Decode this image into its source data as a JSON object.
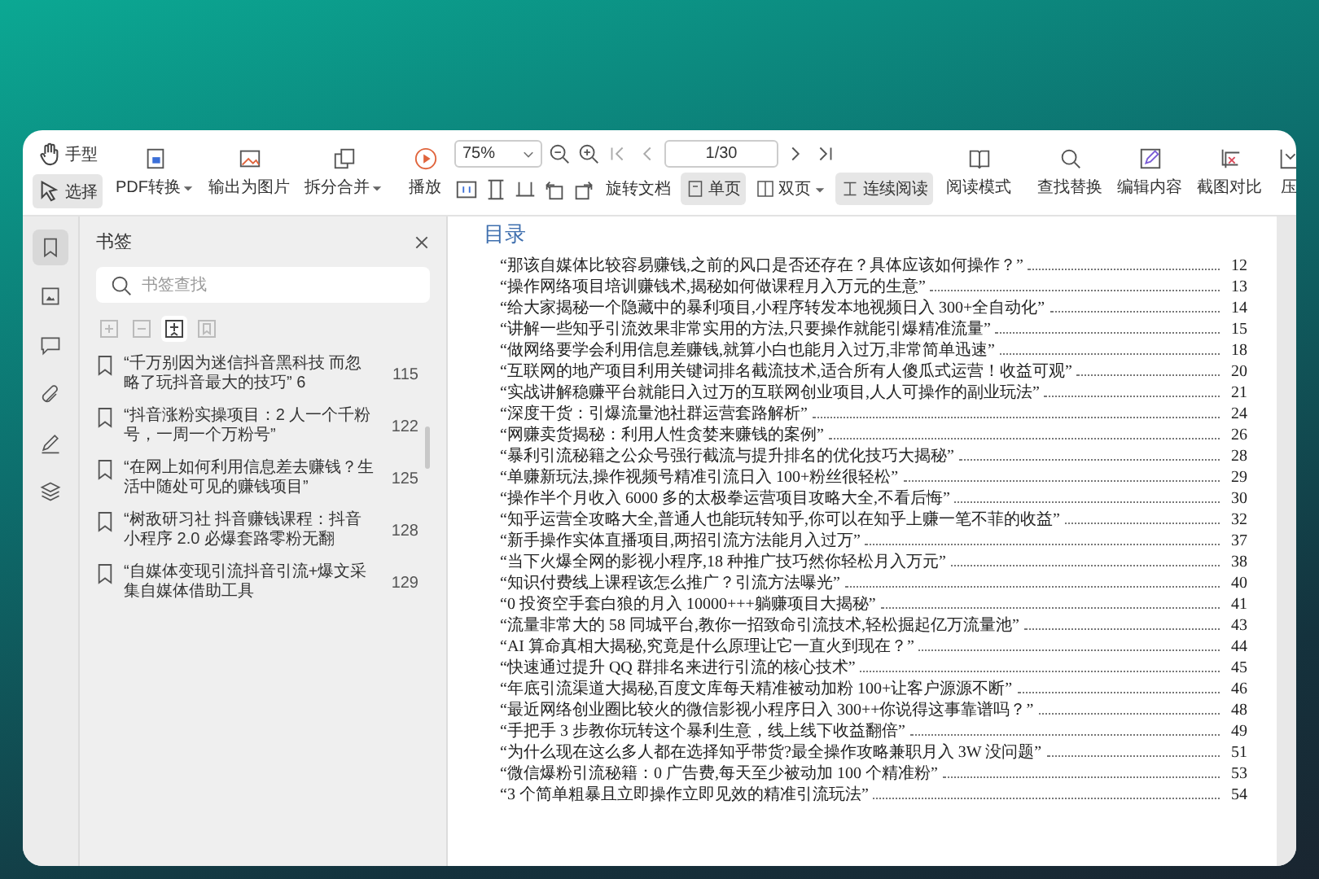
{
  "toolbar": {
    "hand": {
      "label": "手型",
      "selected": false
    },
    "select": {
      "label": "选择",
      "selected": true
    },
    "file_tools": [
      {
        "label": "PDF转换",
        "dropdown": true
      },
      {
        "label": "输出为图片",
        "dropdown": false
      },
      {
        "label": "拆分合并",
        "dropdown": true
      }
    ],
    "play": {
      "label": "播放"
    },
    "zoom": {
      "value": "75%"
    },
    "page": {
      "value": "1/30"
    },
    "rotate": {
      "label": "旋转文档"
    },
    "view_modes": [
      {
        "label": "单页",
        "selected": true,
        "dropdown": false
      },
      {
        "label": "双页",
        "selected": false,
        "dropdown": true
      },
      {
        "label": "连续阅读",
        "selected": true,
        "dropdown": false
      }
    ],
    "reading_mode": {
      "label": "阅读模式"
    },
    "tools": [
      {
        "label": "查找替换"
      },
      {
        "label": "编辑内容"
      },
      {
        "label": "截图对比"
      },
      {
        "label": "压"
      }
    ]
  },
  "sidebar": {
    "rail": [
      {
        "selected": true
      },
      {
        "selected": false
      },
      {
        "selected": false
      },
      {
        "selected": false
      },
      {
        "selected": false
      },
      {
        "selected": false
      }
    ],
    "title": "书签",
    "search": {
      "placeholder": "书签查找"
    },
    "outline_tools": [
      {
        "selected": false
      },
      {
        "selected": false
      },
      {
        "selected": true
      },
      {
        "selected": false
      }
    ],
    "bookmarks": [
      {
        "text": "“千万别因为迷信抖音黑科技 而忽略了玩抖音最大的技巧” 6",
        "page": "115"
      },
      {
        "text": "“抖音涨粉实操项目：2 人一个千粉号，一周一个万粉号”",
        "page": "122"
      },
      {
        "text": "“在网上如何利用信息差去赚钱？生活中随处可见的赚钱项目”",
        "page": "125"
      },
      {
        "text": "“树敌研习社 抖音赚钱课程：抖音小程序 2.0 必爆套路零粉无翻",
        "page": "128"
      },
      {
        "text": "“自媒体变现引流抖音引流+爆文采集自媒体借助工具",
        "page": "129"
      }
    ]
  },
  "document": {
    "heading": "目录",
    "toc": [
      {
        "title": "“那该自媒体比较容易赚钱,之前的风口是否还存在？具体应该如何操作？”",
        "page": "12"
      },
      {
        "title": "“操作网络项目培训赚钱术,揭秘如何做课程月入万元的生意”",
        "page": "13"
      },
      {
        "title": "“给大家揭秘一个隐藏中的暴利项目,小程序转发本地视频日入 300+全自动化”",
        "page": "14"
      },
      {
        "title": "“讲解一些知乎引流效果非常实用的方法,只要操作就能引爆精准流量”",
        "page": "15"
      },
      {
        "title": "“做网络要学会利用信息差赚钱,就算小白也能月入过万,非常简单迅速”",
        "page": "18"
      },
      {
        "title": "“互联网的地产项目利用关键词排名截流技术,适合所有人傻瓜式运营！收益可观”",
        "page": "20"
      },
      {
        "title": "“实战讲解稳赚平台就能日入过万的互联网创业项目,人人可操作的副业玩法”",
        "page": "21"
      },
      {
        "title": "“深度干货：引爆流量池社群运营套路解析”",
        "page": "24"
      },
      {
        "title": "“网赚卖货揭秘：利用人性贪婪来赚钱的案例”",
        "page": "26"
      },
      {
        "title": "“暴利引流秘籍之公众号强行截流与提升排名的优化技巧大揭秘”",
        "page": "28"
      },
      {
        "title": "“单赚新玩法,操作视频号精准引流日入 100+粉丝很轻松”",
        "page": "29"
      },
      {
        "title": "“操作半个月收入 6000 多的太极拳运营项目攻略大全,不看后悔”",
        "page": "30"
      },
      {
        "title": "“知乎运营全攻略大全,普通人也能玩转知乎,你可以在知乎上赚一笔不菲的收益”",
        "page": "32"
      },
      {
        "title": "“新手操作实体直播项目,两招引流方法能月入过万”",
        "page": "37"
      },
      {
        "title": "“当下火爆全网的影视小程序,18 种推广技巧然你轻松月入万元”",
        "page": "38"
      },
      {
        "title": "“知识付费线上课程该怎么推广？引流方法曝光”",
        "page": "40"
      },
      {
        "title": "“0 投资空手套白狼的月入 10000+++躺赚项目大揭秘”",
        "page": "41"
      },
      {
        "title": "“流量非常大的 58 同城平台,教你一招致命引流技术,轻松掘起亿万流量池”",
        "page": "43"
      },
      {
        "title": "“AI 算命真相大揭秘,究竟是什么原理让它一直火到现在？”",
        "page": "44"
      },
      {
        "title": "“快速通过提升 QQ 群排名来进行引流的核心技术”",
        "page": "45"
      },
      {
        "title": "“年底引流渠道大揭秘,百度文库每天精准被动加粉 100+让客户源源不断”",
        "page": "46"
      },
      {
        "title": "“最近网络创业圈比较火的微信影视小程序日入 300++你说得这事靠谱吗？”",
        "page": "48"
      },
      {
        "title": "“手把手 3 步教你玩转这个暴利生意，线上线下收益翻倍”",
        "page": "49"
      },
      {
        "title": "“为什么现在这么多人都在选择知乎带货?最全操作攻略兼职月入 3W 没问题”",
        "page": "51"
      },
      {
        "title": "“微信爆粉引流秘籍：0 广告费,每天至少被动加 100 个精准粉”",
        "page": "53"
      },
      {
        "title": "“3 个简单粗暴且立即操作立即见效的精准引流玩法”",
        "page": "54"
      }
    ]
  }
}
